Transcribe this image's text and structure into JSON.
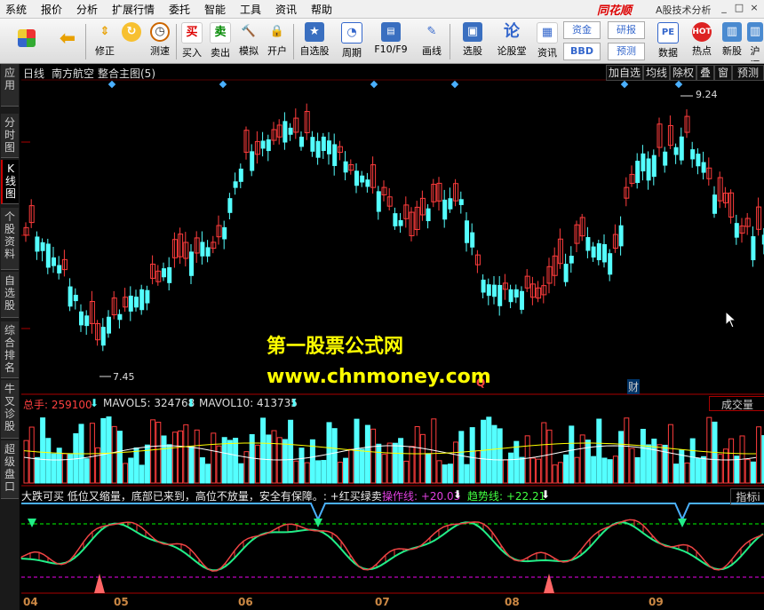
{
  "menu": [
    "系统",
    "报价",
    "分析",
    "扩展行情",
    "委托",
    "智能",
    "工具",
    "资讯",
    "帮助"
  ],
  "brand": "同花顺",
  "window_title": "A股技术分析",
  "window_buttons": [
    "_",
    "□",
    "×"
  ],
  "toolbar": {
    "items": [
      {
        "label": "",
        "icon": "multi-window-icon"
      },
      {
        "label": "",
        "icon": "back-arrow-icon"
      },
      {
        "label": "修正",
        "icon": "up-down-icon"
      },
      {
        "label": "测速",
        "icon": "clock-icon"
      },
      {
        "label": "买入",
        "glyph": "买",
        "icon": "buy-icon"
      },
      {
        "label": "卖出",
        "glyph": "卖",
        "icon": "sell-icon"
      },
      {
        "label": "模拟",
        "icon": "hammer-icon"
      },
      {
        "label": "开户",
        "icon": "lock-icon"
      },
      {
        "label": "自选股",
        "icon": "star-folder-icon"
      },
      {
        "label": "周期",
        "icon": "cycle-icon"
      },
      {
        "label": "F10/F9",
        "icon": "f10-icon"
      },
      {
        "label": "画线",
        "icon": "pencil-icon"
      },
      {
        "label": "选股",
        "icon": "monitor-icon"
      },
      {
        "label": "论股堂",
        "icon": "forum-icon"
      },
      {
        "label": "资讯",
        "glyph": "资金",
        "icon": "fund-icon"
      },
      {
        "label": "",
        "glyph": "BBD",
        "icon": "bbd-icon"
      },
      {
        "label": "",
        "glyph": "研报",
        "icon": "report-icon"
      },
      {
        "label": "",
        "glyph": "预测",
        "icon": "forecast-icon"
      },
      {
        "label": "数据",
        "glyph": "PE",
        "icon": "data-icon"
      },
      {
        "label": "热点",
        "glyph": "HOT",
        "icon": "hot-icon"
      },
      {
        "label": "新股",
        "icon": "new-stock-icon"
      },
      {
        "label": "沪深",
        "icon": "market-icon"
      }
    ]
  },
  "sidebar": [
    "应用",
    "分时图",
    "K线图",
    "个股资料",
    "自选股",
    "综合排名",
    "牛叉诊股",
    "超级盘口"
  ],
  "kchart": {
    "period": "日线",
    "stock": "南方航空",
    "main_chart": "整合主图(5)",
    "right_buttons": [
      "加自选",
      "均线",
      "除权",
      "叠",
      "窗",
      "预测"
    ],
    "high_label": "9.24",
    "low_label": "7.45",
    "cai_label": "财",
    "q_label": "Q"
  },
  "volume": {
    "total": "总手: 259100",
    "ma5": "MAVOL5: 324768",
    "ma10": "MAVOL10: 413735",
    "right_label": "成交量"
  },
  "indicator": {
    "desc": "大跌可买  低位又缩量，底部已来到，高位不放量，安全有保障。: +红买绿卖",
    "op_line": "操作线: +20.03",
    "trend_line": "趋势线: +22.21",
    "right_label": "指标i"
  },
  "watermark": {
    "line1": "第一股票公式网",
    "line2": "www.chnmoney.com"
  },
  "dates": [
    "04",
    "05",
    "06",
    "07",
    "08",
    "09"
  ],
  "colors": {
    "up": "#ff3c3c",
    "down": "#54ffff",
    "text_red": "#ff4040",
    "text_yellow": "#ffff00",
    "text_white": "#ffffff",
    "ma": "#ffff00"
  }
}
